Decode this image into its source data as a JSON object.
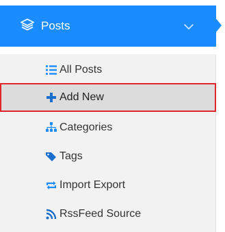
{
  "header": {
    "label": "Posts",
    "icon": "layers-icon",
    "chevron": "chevron-down-icon",
    "background_color": "#1a8cff"
  },
  "submenu": {
    "items": [
      {
        "label": "All Posts",
        "icon": "list-icon"
      },
      {
        "label": "Add New",
        "icon": "plus-icon",
        "active": true
      },
      {
        "label": "Categories",
        "icon": "sitemap-icon"
      },
      {
        "label": "Tags",
        "icon": "tag-icon"
      },
      {
        "label": "Import Export",
        "icon": "exchange-icon"
      },
      {
        "label": "RssFeed Source",
        "icon": "rss-icon"
      }
    ],
    "active_border_color": "#e0262b",
    "icon_color": "#1a8cff"
  }
}
